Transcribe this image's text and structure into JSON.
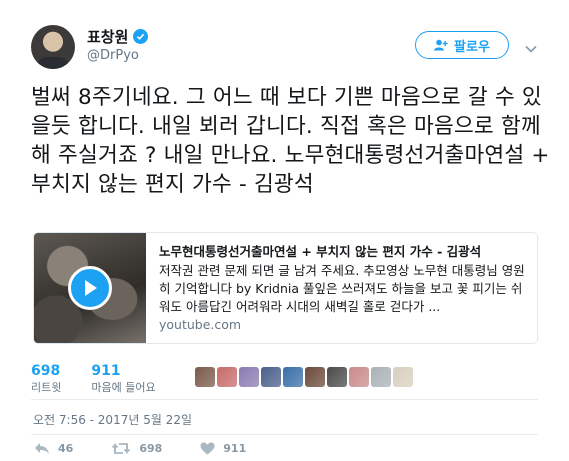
{
  "user": {
    "display_name": "표창원",
    "handle": "@DrPyo"
  },
  "follow_button": {
    "label": "팔로우"
  },
  "tweet": {
    "text": "벌써 8주기네요. 그 어느 때 보다 기쁜 마음으로 갈 수 있을듯 합니다. 내일 뵈러 갑니다. 직접 혹은 마음으로 함께 해 주실거죠 ? 내일 만나요. 노무현대통령선거출마연설 + 부치지 않는 편지 가수 - 김광석"
  },
  "card": {
    "title": "노무현대통령선거출마연설 + 부치지 않는 편지 가수 - 김광석",
    "description": "저작권 관련 문제 되면 글 남겨 주세요. 추모영상 노무현 대통령님 영원히 기억합니다 by Kridnia 풀잎은 쓰러져도 하늘을 보고 꽃 피기는 쉬워도 아름답긴 어려워라 시대의 새벽길 홀로 걷다가 ...",
    "domain": "youtube.com"
  },
  "stats": {
    "retweets": {
      "count": "698",
      "label": "리트윗"
    },
    "likes": {
      "count": "911",
      "label": "마음에 들어요"
    }
  },
  "likers": {
    "colors": [
      "#7a5a4a",
      "#c86b6b",
      "#8a7bb0",
      "#4a5f8a",
      "#3a6ea8",
      "#6b4a3a",
      "#4a4a4a",
      "#c98a8a",
      "#a9b1b8",
      "#d8d0c0"
    ]
  },
  "timestamp": "오전 7:56 - 2017년 5월 22일",
  "actions": {
    "reply_count": "46",
    "retweet_count": "698",
    "like_count": "911"
  },
  "colors": {
    "accent": "#1da1f2",
    "secondary_text": "#657786",
    "action_gray": "#8899a6"
  }
}
